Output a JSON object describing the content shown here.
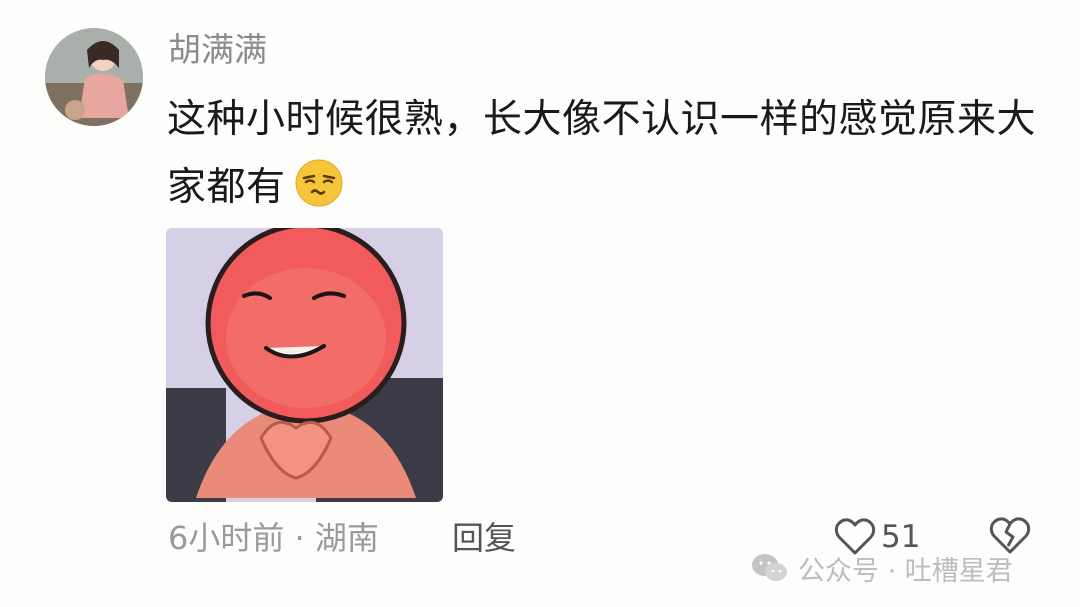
{
  "comment": {
    "username": "胡满满",
    "text": "这种小时候很熟，长大像不认识一样的感觉原来大家都有",
    "emoji": "smirk-emoji-icon",
    "sticker": "red-face-sticker-image",
    "time_location": "6小时前 · 湖南",
    "reply_label": "回复",
    "like_count": "51"
  },
  "watermark": {
    "text": "公众号 · 吐槽星君",
    "icon": "wechat-icon"
  },
  "colors": {
    "background": "#fdfdfb",
    "username": "#8c8c8c",
    "text": "#1a1a1a",
    "meta": "#9a9a9a"
  }
}
